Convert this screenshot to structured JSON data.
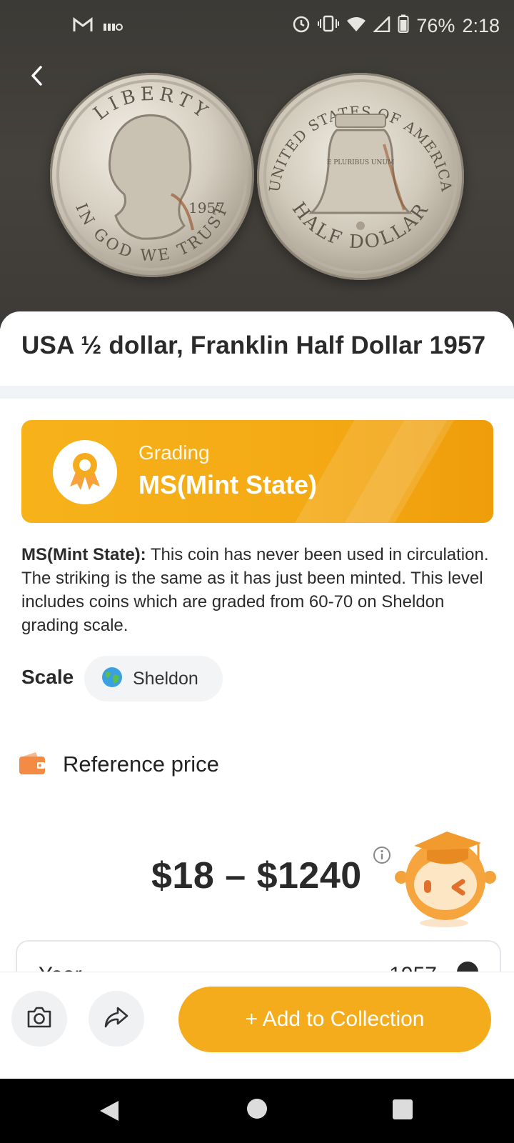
{
  "status_bar": {
    "battery": "76%",
    "time": "2:18"
  },
  "item": {
    "title": "USA ½ dollar, Franklin Half Dollar 1957",
    "coin_front_text": {
      "top": "LIBERTY",
      "bottom": "IN GOD WE TRUST",
      "date": "1957"
    },
    "coin_back_text": {
      "top": "UNITED STATES OF AMERICA",
      "bottom": "HALF DOLLAR",
      "motto": "E PLURIBUS UNUM"
    }
  },
  "grading": {
    "label": "Grading",
    "value": "MS(Mint State)",
    "description_term": "MS(Mint State):",
    "description_text": " This coin has never been used in circulation. The striking is the same as it has just been minted. This level includes coins which are graded from 60-70 on Sheldon grading scale."
  },
  "scale": {
    "label": "Scale",
    "chip": "Sheldon"
  },
  "reference": {
    "label": "Reference price",
    "price": "$18 – $1240"
  },
  "details": {
    "year_label": "Year",
    "year_value": "1957"
  },
  "actions": {
    "add_label": "+ Add to Collection"
  },
  "colors": {
    "accent": "#f5ac1c",
    "card_gradient_start": "#f7b21a",
    "card_gradient_end": "#ef9d0a"
  },
  "icons": {
    "back": "chevron-left-icon",
    "camera": "camera-icon",
    "share": "share-icon",
    "wallet": "wallet-icon",
    "globe": "globe-icon",
    "info": "info-icon",
    "badge": "award-ribbon-icon"
  }
}
